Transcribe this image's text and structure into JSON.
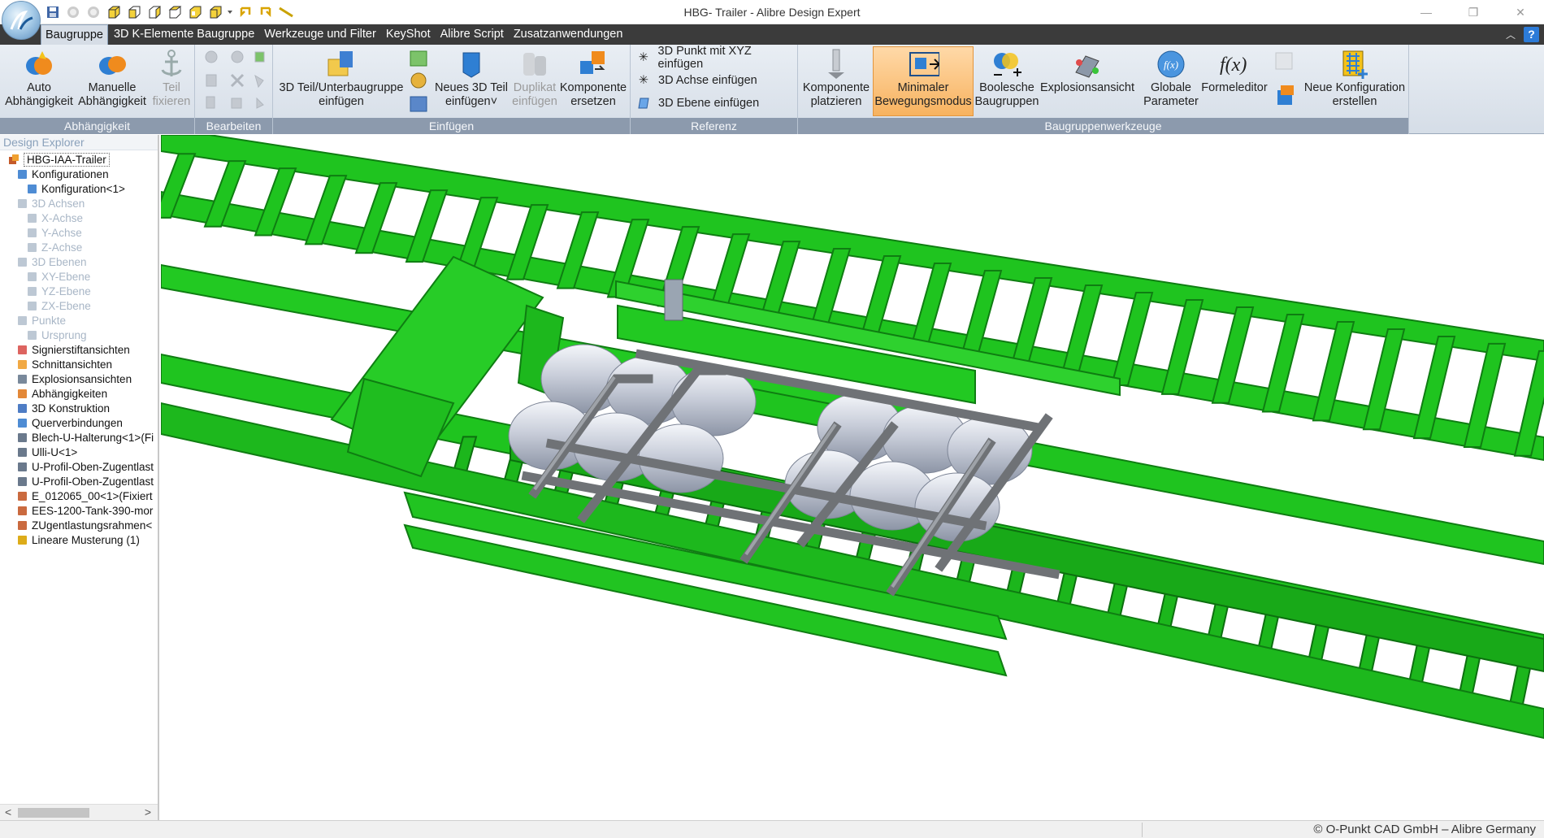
{
  "window": {
    "title": "HBG-      Trailer - Alibre Design Expert",
    "minimize": "—",
    "restore": "❐",
    "close": "✕"
  },
  "tabs": [
    {
      "label": "Baugruppe",
      "active": true
    },
    {
      "label": "3D K-Elemente Baugruppe",
      "active": false
    },
    {
      "label": "Werkzeuge und Filter",
      "active": false
    },
    {
      "label": "KeyShot",
      "active": false
    },
    {
      "label": "Alibre Script",
      "active": false
    },
    {
      "label": "Zusatzanwendungen",
      "active": false
    }
  ],
  "ribbon": {
    "groups": {
      "abhaengigkeit": "Abhängigkeit",
      "bearbeiten": "Bearbeiten",
      "einfuegen": "Einfügen",
      "referenz": "Referenz",
      "baugruppenwerkzeuge": "Baugruppenwerkzeuge"
    },
    "auto": {
      "line1": "Auto",
      "line2": "Abhängigkeit"
    },
    "manuelle": {
      "line1": "Manuelle",
      "line2": "Abhängigkeit"
    },
    "teil_fixieren": {
      "line1": "Teil",
      "line2": "fixieren"
    },
    "teil_unterbaugruppe": {
      "line1": "3D Teil/Unterbaugruppe",
      "line2": "einfügen"
    },
    "neues_teil": {
      "line1": "Neues 3D Teil",
      "line2": "einfügen˅"
    },
    "duplikat": {
      "line1": "Duplikat",
      "line2": "einfügen"
    },
    "komponente_ersetzen": {
      "line1": "Komponente",
      "line2": "ersetzen"
    },
    "punkt": "3D Punkt mit XYZ einfügen",
    "achse": "3D Achse einfügen",
    "ebene": "3D Ebene einfügen",
    "komponente_platzieren": {
      "line1": "Komponente",
      "line2": "platzieren"
    },
    "minimaler": {
      "line1": "Minimaler",
      "line2": "Bewegungsmodus"
    },
    "boolesche": {
      "line1": "Boolesche",
      "line2": "Baugruppen"
    },
    "explosionsansicht": {
      "line1": "Explosionsansicht",
      "line2": ""
    },
    "globale": {
      "line1": "Globale",
      "line2": "Parameter"
    },
    "formeleditor": {
      "line1": "Formeleditor",
      "line2": ""
    },
    "neue_konfiguration": {
      "line1": "Neue Konfiguration",
      "line2": "erstellen"
    }
  },
  "explorer": {
    "title": "Design Explorer",
    "root": "HBG-IAA-Trailer",
    "items": [
      {
        "label": "Konfigurationen",
        "icon": "configurations-icon",
        "dim": false
      },
      {
        "label": "Konfiguration<1>",
        "icon": "configuration-icon",
        "dim": false
      },
      {
        "label": "3D Achsen",
        "icon": "axes-icon",
        "dim": true
      },
      {
        "label": "X-Achse",
        "icon": "axis-icon",
        "dim": true
      },
      {
        "label": "Y-Achse",
        "icon": "axis-icon",
        "dim": true
      },
      {
        "label": "Z-Achse",
        "icon": "axis-icon",
        "dim": true
      },
      {
        "label": "3D Ebenen",
        "icon": "planes-icon",
        "dim": true
      },
      {
        "label": "XY-Ebene",
        "icon": "plane-icon",
        "dim": true
      },
      {
        "label": "YZ-Ebene",
        "icon": "plane-icon",
        "dim": true
      },
      {
        "label": "ZX-Ebene",
        "icon": "plane-icon",
        "dim": true
      },
      {
        "label": "Punkte",
        "icon": "points-icon",
        "dim": true
      },
      {
        "label": "Ursprung",
        "icon": "origin-icon",
        "dim": true
      },
      {
        "label": "Signierstiftansichten",
        "icon": "markup-views-icon",
        "dim": false
      },
      {
        "label": "Schnittansichten",
        "icon": "section-views-icon",
        "dim": false
      },
      {
        "label": "Explosionsansichten",
        "icon": "exploded-views-icon",
        "dim": false
      },
      {
        "label": "Abhängigkeiten",
        "icon": "constraints-icon",
        "dim": false
      },
      {
        "label": "3D Konstruktion",
        "icon": "construction-icon",
        "dim": false
      },
      {
        "label": "Querverbindungen",
        "icon": "cross-links-icon",
        "dim": false
      },
      {
        "label": "Blech-U-Halterung<1>(Fi",
        "icon": "part-icon",
        "dim": false
      },
      {
        "label": "Ulli-U<1>",
        "icon": "part-icon",
        "dim": false
      },
      {
        "label": "U-Profil-Oben-Zugentlast",
        "icon": "part-icon",
        "dim": false
      },
      {
        "label": "U-Profil-Oben-Zugentlast",
        "icon": "part-icon",
        "dim": false
      },
      {
        "label": "E_012065_00<1>(Fixiert",
        "icon": "assembly-icon",
        "dim": false
      },
      {
        "label": "EES-1200-Tank-390-mor",
        "icon": "assembly-icon",
        "dim": false
      },
      {
        "label": "ZUgentlastungsrahmen<",
        "icon": "assembly-icon",
        "dim": false
      },
      {
        "label": "Lineare Musterung (1)",
        "icon": "pattern-icon",
        "dim": false
      }
    ],
    "scroll_left": "<",
    "scroll_right": ">"
  },
  "status": {
    "copyright": "© O-Punkt CAD GmbH – Alibre Germany"
  },
  "colors": {
    "frame_green": "#1fc41f",
    "frame_dark_green": "#0f7d12",
    "tank_silver": "#d8dde6",
    "bracket_grey": "#6f7276",
    "highlight_orange": "#f7b25f"
  }
}
